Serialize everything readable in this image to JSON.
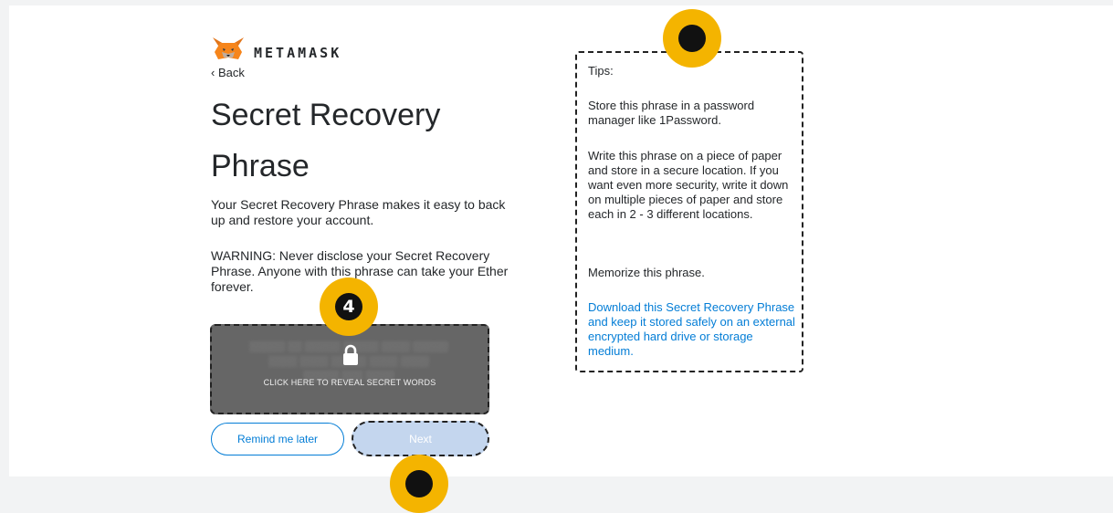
{
  "brand": {
    "name": "METAMASK",
    "logo_icon": "fox-icon"
  },
  "nav": {
    "back_label": "‹ Back"
  },
  "page": {
    "title": "Secret Recovery Phrase",
    "description": "Your Secret Recovery Phrase makes it easy to back up and restore your account.",
    "warning": "WARNING: Never disclose your Secret Recovery Phrase. Anyone with this phrase can take your Ether forever."
  },
  "reveal": {
    "label": "CLICK HERE TO REVEAL SECRET WORDS",
    "icon": "lock-icon"
  },
  "buttons": {
    "remind_label": "Remind me later",
    "next_label": "Next"
  },
  "tips": {
    "heading": "Tips:",
    "items": [
      "Store this phrase in a password manager like 1Password.",
      "Write this phrase on a piece of paper and store in a secure location. If you want even more security, write it down on multiple pieces of paper and store each in 2 - 3 different locations.",
      "Memorize this phrase."
    ],
    "download_link": "Download this Secret Recovery Phrase and keep it stored safely on an external encrypted hard drive or storage medium."
  },
  "markers": {
    "step_label": "4"
  },
  "colors": {
    "accent": "#037dd6",
    "marker": "#f4b400",
    "reveal_bg": "#666666",
    "next_disabled": "#c4d6ee"
  }
}
